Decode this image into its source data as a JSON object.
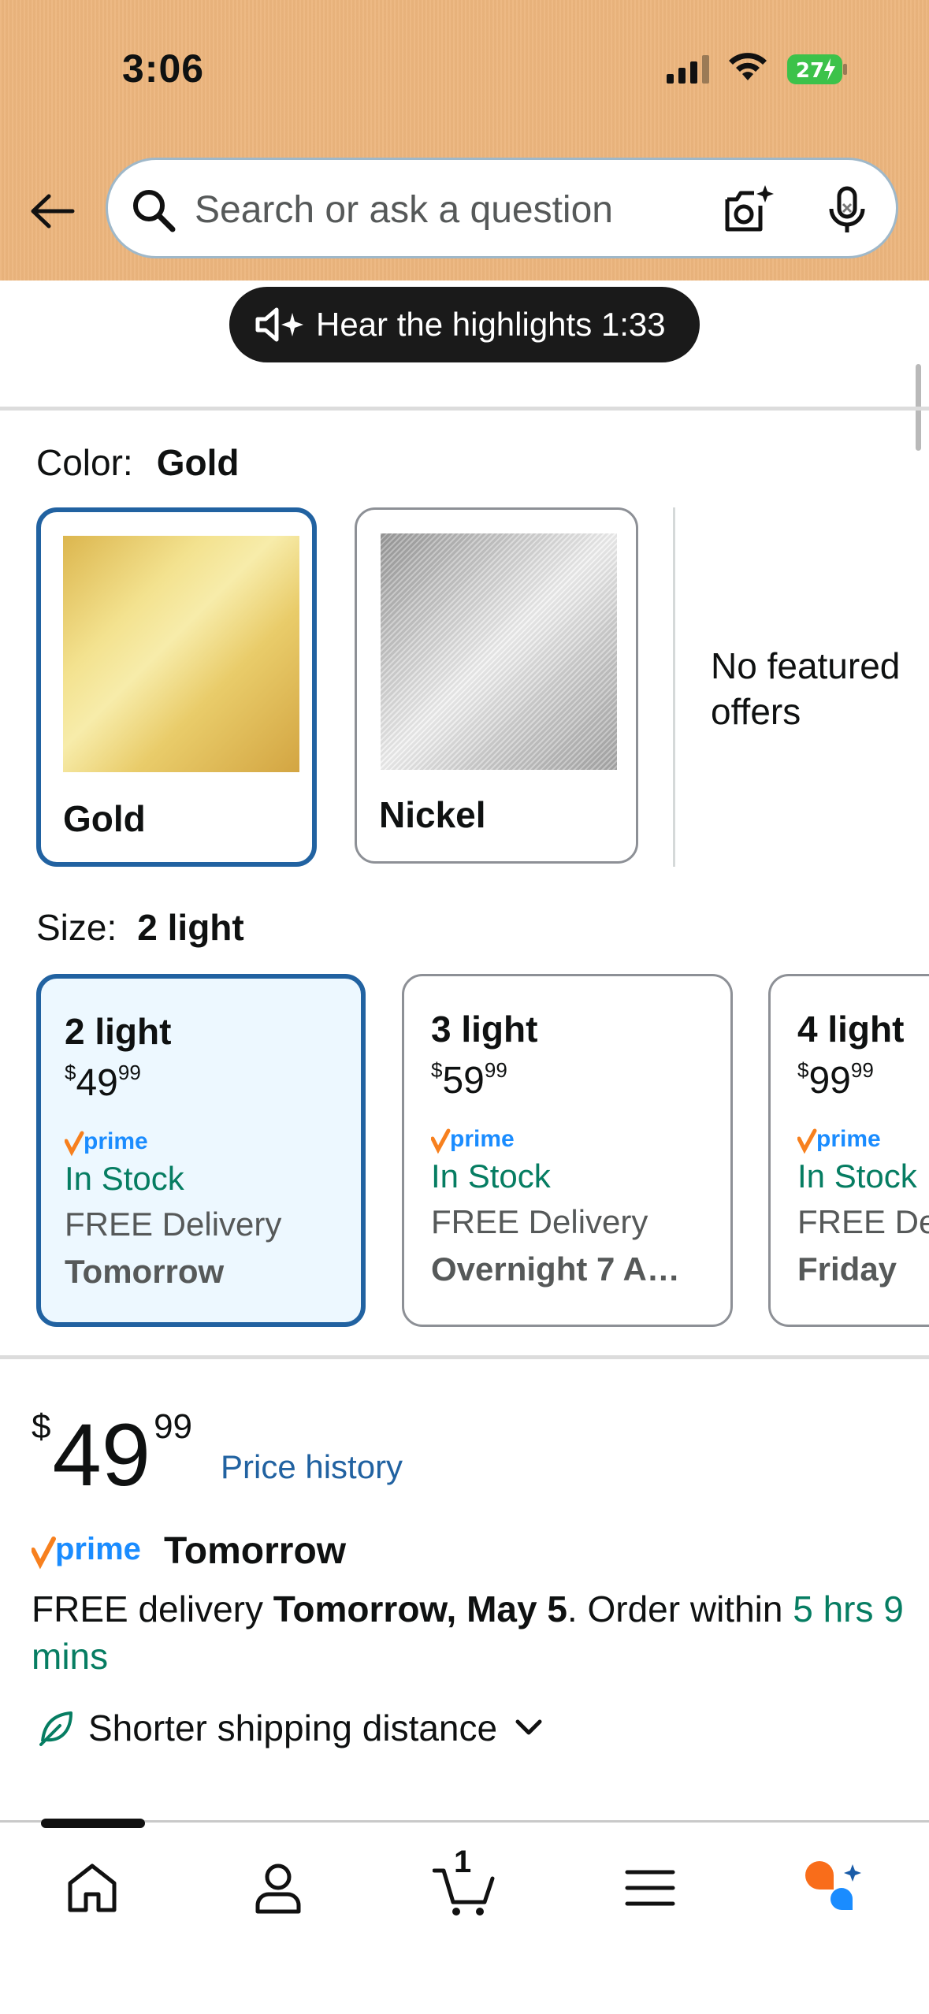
{
  "status_bar": {
    "time": "3:06",
    "battery": "27"
  },
  "header": {
    "search_placeholder": "Search or ask a question"
  },
  "highlights": {
    "label": "Hear the highlights 1:33"
  },
  "color": {
    "label": "Color:",
    "selected": "Gold",
    "options": [
      {
        "name": "Gold",
        "selected": true
      },
      {
        "name": "Nickel",
        "selected": false
      }
    ],
    "no_offers": "No featured offers"
  },
  "size": {
    "label": "Size:",
    "selected": "2 light",
    "options": [
      {
        "name": "2 light",
        "price_dollars": "49",
        "price_cents": "99",
        "stock": "In Stock",
        "delivery": "FREE Delivery",
        "delivery_day": "Tomorrow"
      },
      {
        "name": "3 light",
        "price_dollars": "59",
        "price_cents": "99",
        "stock": "In Stock",
        "delivery": "FREE Delivery",
        "delivery_day": "Overnight 7 A…"
      },
      {
        "name": "4 light",
        "price_dollars": "99",
        "price_cents": "99",
        "stock": "In Stock",
        "delivery": "FREE Del",
        "delivery_day": "Friday"
      }
    ],
    "currency": "$",
    "prime_text": "prime"
  },
  "price": {
    "currency": "$",
    "dollars": "49",
    "cents": "99",
    "history_link": "Price history"
  },
  "delivery": {
    "prime_text": "prime",
    "prime_tomorrow": "Tomorrow",
    "line_prefix": "FREE delivery ",
    "line_date": "Tomorrow, May 5",
    "line_middle": ". Order within ",
    "line_countdown": "5 hrs 9 mins"
  },
  "shipping": {
    "label": "Shorter shipping distance"
  },
  "bottom_nav": {
    "cart_count": "1",
    "items": [
      "home-icon",
      "account-icon",
      "cart-icon",
      "menu-icon",
      "rufus-icon"
    ]
  },
  "colors": {
    "header_bg": "#ecb57d",
    "selected_border": "#2162a1",
    "selected_bg": "#edf8ff",
    "stock_green": "#067d62",
    "link_blue": "#2162a1",
    "prime_blue": "#1a8cff",
    "prime_check": "#f7801e"
  }
}
